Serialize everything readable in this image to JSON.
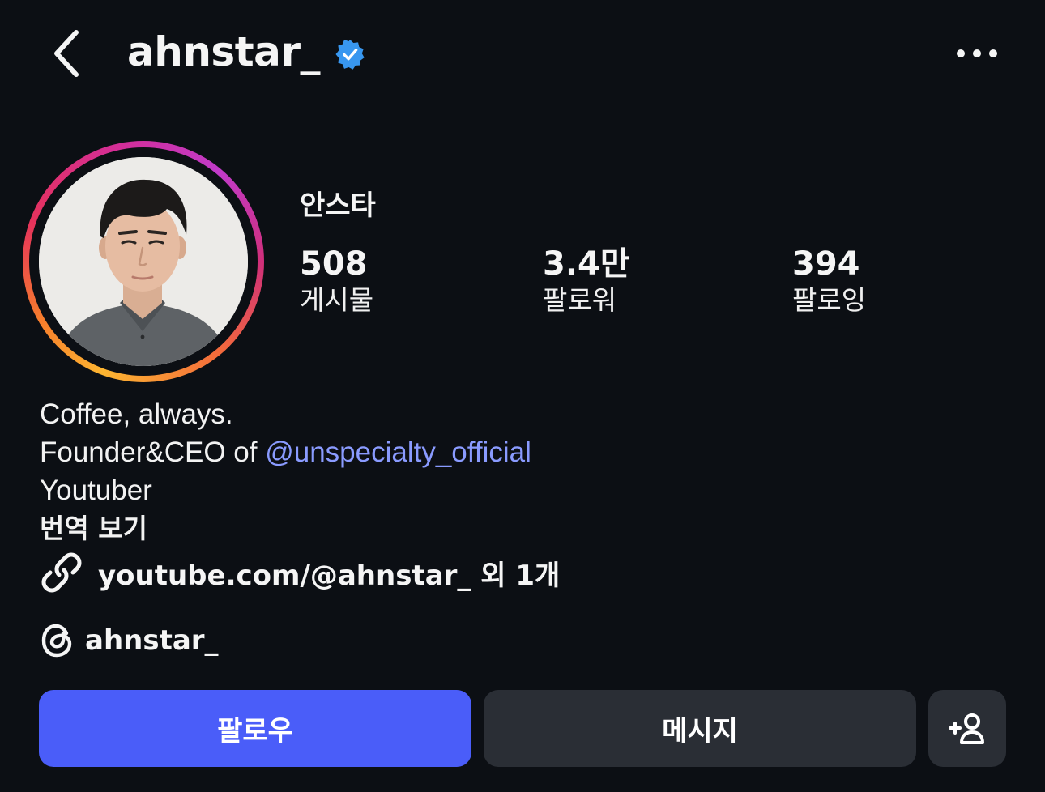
{
  "header": {
    "username": "ahnstar_",
    "verified": true,
    "back_icon": "chevron-left-icon",
    "more_icon": "more-horizontal-icon"
  },
  "profile": {
    "display_name": "안스타",
    "stats": [
      {
        "value": "508",
        "label": "게시물"
      },
      {
        "value": "3.4만",
        "label": "팔로워"
      },
      {
        "value": "394",
        "label": "팔로잉"
      }
    ]
  },
  "bio": {
    "line1": "Coffee, always.",
    "line2_prefix": "Founder&CEO of ",
    "line2_mention": "@unspecialty_official",
    "line3": "Youtuber",
    "translate": "번역 보기"
  },
  "link": {
    "icon": "link-icon",
    "text": "youtube.com/@ahnstar_ 외 1개"
  },
  "threads": {
    "icon": "threads-icon",
    "text": "ahnstar_"
  },
  "actions": {
    "follow": "팔로우",
    "message": "메시지",
    "add_icon": "add-person-icon"
  },
  "colors": {
    "background": "#0c0f14",
    "follow_button": "#4a5df9",
    "secondary_button": "#2a2e35",
    "mention": "#8a9bff",
    "verified": "#3897f0"
  }
}
